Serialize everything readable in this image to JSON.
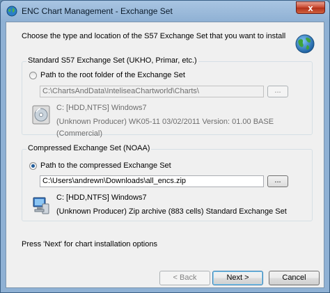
{
  "window": {
    "title": "ENC Chart Management - Exchange Set",
    "close_label": "x"
  },
  "intro": "Choose the type and location of the S57 Exchange Set that you want to install",
  "standard_group": {
    "title": "Standard S57 Exchange Set (UKHO, Primar, etc.)",
    "radio_label": "Path to the root folder of the Exchange Set",
    "checked": false,
    "path": "C:\\ChartsAndData\\InteliseaChartworld\\Charts\\",
    "browse_label": "...",
    "drive": "C: [HDD,NTFS] Windows7",
    "details": "(Unknown Producer) WK05-11 03/02/2011 Version: 01.00 BASE (Commercial)"
  },
  "compressed_group": {
    "title": "Compressed Exchange Set (NOAA)",
    "radio_label": "Path to the compressed Exchange Set",
    "checked": true,
    "path": "C:\\Users\\andrewn\\Downloads\\all_encs.zip",
    "browse_label": "...",
    "drive": "C: [HDD,NTFS] Windows7",
    "details": "(Unknown Producer) Zip archive (883 cells) Standard Exchange Set"
  },
  "footer": "Press 'Next' for chart installation options",
  "buttons": {
    "back": "< Back",
    "next": "Next >",
    "cancel": "Cancel"
  },
  "colors": {
    "titlebar": "#a9c5e2",
    "close": "#c7452c",
    "dialog_bg": "#f0f0f0",
    "radio_dot": "#1f5c9b"
  }
}
